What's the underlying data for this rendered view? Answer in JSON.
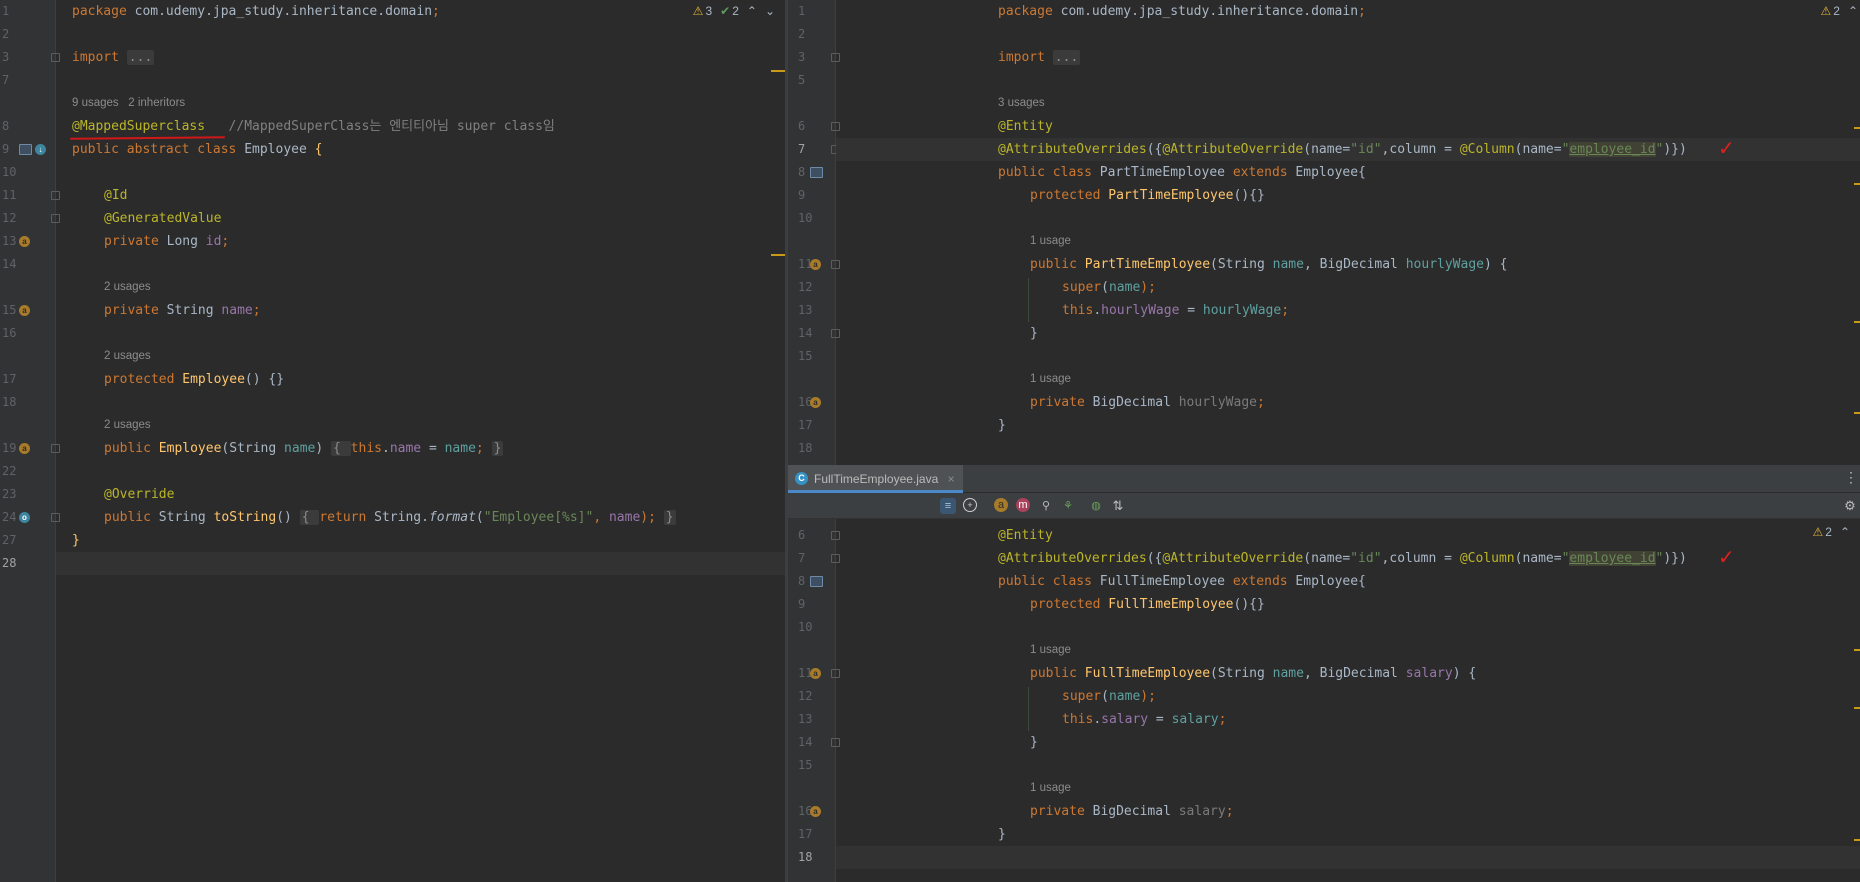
{
  "left_editor": {
    "inspections": {
      "warnings": "3",
      "ok": "2"
    },
    "line_numbers": [
      "1",
      "2",
      "3",
      "7",
      "",
      "8",
      "9",
      "10",
      "11",
      "12",
      "13",
      "14",
      "",
      "15",
      "16",
      "",
      "17",
      "18",
      "",
      "19",
      "22",
      "23",
      "24",
      "27",
      "28"
    ],
    "hints": {
      "usages_inheritors": "9 usages   2 inheritors",
      "usages_name": "2 usages",
      "usages_ctor": "2 usages",
      "usages_ctor2": "2 usages"
    },
    "code": {
      "package_kw": "package",
      "package_name": " com.udemy.jpa_study.inheritance.domain",
      "semi": ";",
      "import_kw": "import",
      "import_fold": "...",
      "mapped_ann": "@MappedSuperclass",
      "mapped_comment": "   //MappedSuperClass는 엔티티아님 super class임",
      "class_decl_kw": "public abstract class",
      "class_name": " Employee ",
      "brace_open": "{",
      "id_ann": "@Id",
      "gen_ann": "@GeneratedValue",
      "id_field_kw": "private",
      "id_field_type": " Long ",
      "id_field_name": "id",
      "name_field_kw": "private",
      "name_field_type": " String ",
      "name_field_name": "name",
      "ctor1_kw": "protected",
      "ctor1_name": " Employee",
      "ctor1_rest": "() {}",
      "ctor2_kw": "public",
      "ctor2_name": " Employee",
      "ctor2_p1": "(String ",
      "ctor2_param": "name",
      "ctor2_p2": ") ",
      "ctor2_body_open": "{ ",
      "ctor2_this": "this",
      "ctor2_dot": ".",
      "ctor2_field": "name",
      "ctor2_eq": " = ",
      "ctor2_val": "name",
      "ctor2_semi": "; ",
      "ctor2_close": "}",
      "override_ann": "@Override",
      "tostr_kw": "public",
      "tostr_type": " String ",
      "tostr_name": "toString",
      "tostr_paren": "() ",
      "tostr_open": "{ ",
      "tostr_return": "return",
      "tostr_cls": " String.",
      "tostr_fmt": "format",
      "tostr_p": "(",
      "tostr_str": "\"Employee[%s]\"",
      "tostr_comma": ", ",
      "tostr_arg": "name",
      "tostr_end": "); ",
      "tostr_close": "}",
      "class_close": "}"
    }
  },
  "right_top_editor": {
    "inspections": {
      "warnings": "2"
    },
    "line_numbers": [
      "1",
      "2",
      "3",
      "5",
      "",
      "6",
      "7",
      "8",
      "9",
      "10",
      "",
      "11",
      "12",
      "13",
      "14",
      "15",
      "",
      "16",
      "17",
      "18"
    ],
    "hints": {
      "usages_class": "3 usages",
      "usages_ctor": "1 usage",
      "usages_field": "1 usage"
    },
    "code": {
      "package_kw": "package",
      "package_name": " com.udemy.jpa_study.inheritance.domain",
      "semi": ";",
      "import_kw": "import",
      "import_fold": "...",
      "entity_ann": "@Entity",
      "ao_ann": "@AttributeOverrides",
      "ao_p1": "({",
      "ao2_ann": "@AttributeOverride",
      "ao_p2": "(name=",
      "ao_id": "\"id\"",
      "ao_p3": ",column = ",
      "col_ann": "@Column",
      "ao_p4": "(name=",
      "ao_q1": "\"",
      "ao_emp": "employee_id",
      "ao_q2": "\"",
      "ao_p5": ")})",
      "class_kw": "public class",
      "class_name": " PartTimeEmployee ",
      "extends_kw": "extends",
      "class_super": " Employee{",
      "ctor1_kw": "protected",
      "ctor1_name": " PartTimeEmployee",
      "ctor1_rest": "(){}",
      "ctor2_kw": "public",
      "ctor2_name": " PartTimeEmployee",
      "ctor2_p1": "(String ",
      "ctor2_param1": "name",
      "ctor2_p2": ", BigDecimal ",
      "ctor2_param2": "hourlyWage",
      "ctor2_p3": ") {",
      "super_kw": "super",
      "super_p": "(",
      "super_arg": "name",
      "super_end": ");",
      "this_kw": "this",
      "this_dot": ".",
      "this_field": "hourlyWage",
      "this_eq": " = ",
      "this_val": "hourlyWage",
      "this_semi": ";",
      "method_close": "}",
      "field_kw": "private",
      "field_type": " BigDecimal ",
      "field_name": "hourlyWage",
      "field_semi": ";",
      "class_close": "}"
    }
  },
  "bottom_tab": {
    "label": "FullTimeEmployee.java",
    "close": "×"
  },
  "right_bottom_editor": {
    "inspections": {
      "warnings": "2"
    },
    "line_numbers": [
      "6",
      "7",
      "8",
      "9",
      "10",
      "",
      "11",
      "12",
      "13",
      "14",
      "15",
      "",
      "16",
      "17",
      "18"
    ],
    "hints": {
      "usages_ctor": "1 usage",
      "usages_field": "1 usage"
    },
    "code": {
      "entity_ann": "@Entity",
      "ao_ann": "@AttributeOverrides",
      "ao_p1": "({",
      "ao2_ann": "@AttributeOverride",
      "ao_p2": "(name=",
      "ao_id": "\"id\"",
      "ao_p3": ",column = ",
      "col_ann": "@Column",
      "ao_p4": "(name=",
      "ao_q1": "\"",
      "ao_emp": "employee_id",
      "ao_q2": "\"",
      "ao_p5": ")})",
      "class_kw": "public class",
      "class_name": " FullTimeEmployee ",
      "extends_kw": "extends",
      "class_super": " Employee{",
      "ctor1_kw": "protected",
      "ctor1_name": " FullTimeEmployee",
      "ctor1_rest": "(){}",
      "ctor2_kw": "public",
      "ctor2_name": " FullTimeEmployee",
      "ctor2_p1": "(String ",
      "ctor2_param1": "name",
      "ctor2_p2": ", BigDecimal ",
      "ctor2_param2": "salary",
      "ctor2_p3": ") {",
      "super_kw": "super",
      "super_p": "(",
      "super_arg": "name",
      "super_end": ");",
      "this_kw": "this",
      "this_dot": ".",
      "this_field": "salary",
      "this_eq": " = ",
      "this_val": "salary",
      "this_semi": ";",
      "method_close": "}",
      "field_kw": "private",
      "field_type": " BigDecimal ",
      "field_name": "salary",
      "field_semi": ";",
      "class_close": "}"
    }
  },
  "icons": {
    "warning": "⚠",
    "ok": "✔",
    "up": "⌃",
    "down": "⌄",
    "check_mark": "✓",
    "gear": "⚙",
    "more": "⋮",
    "sort": "⇅"
  }
}
